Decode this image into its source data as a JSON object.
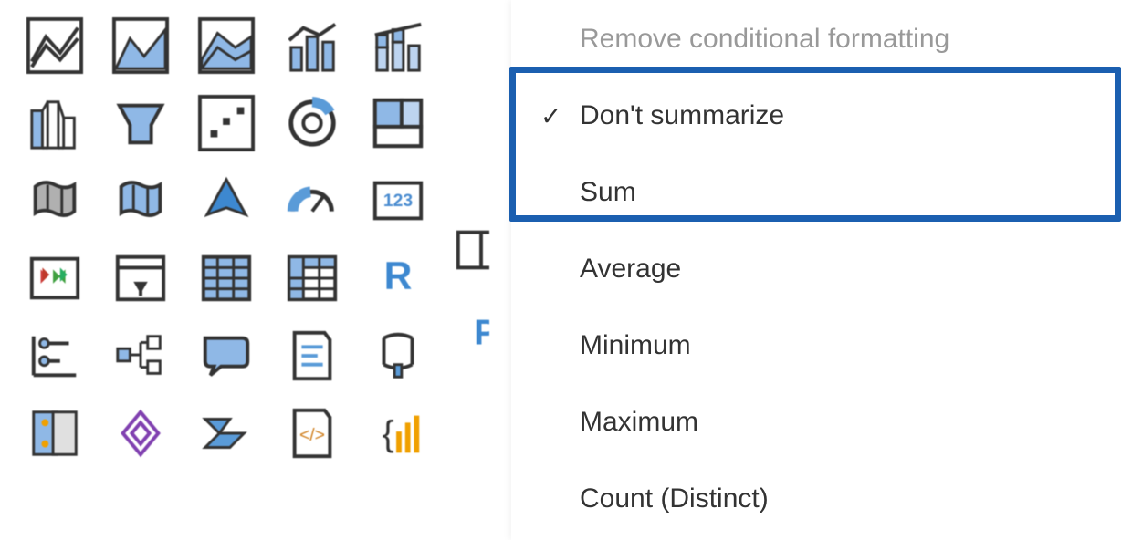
{
  "context_menu": {
    "remove_cf": "Remove conditional formatting",
    "dont_summarize": "Don't summarize",
    "sum": "Sum",
    "average": "Average",
    "minimum": "Minimum",
    "maximum": "Maximum",
    "count_distinct": "Count (Distinct)"
  },
  "viz_icons": {
    "r_label": "R"
  }
}
